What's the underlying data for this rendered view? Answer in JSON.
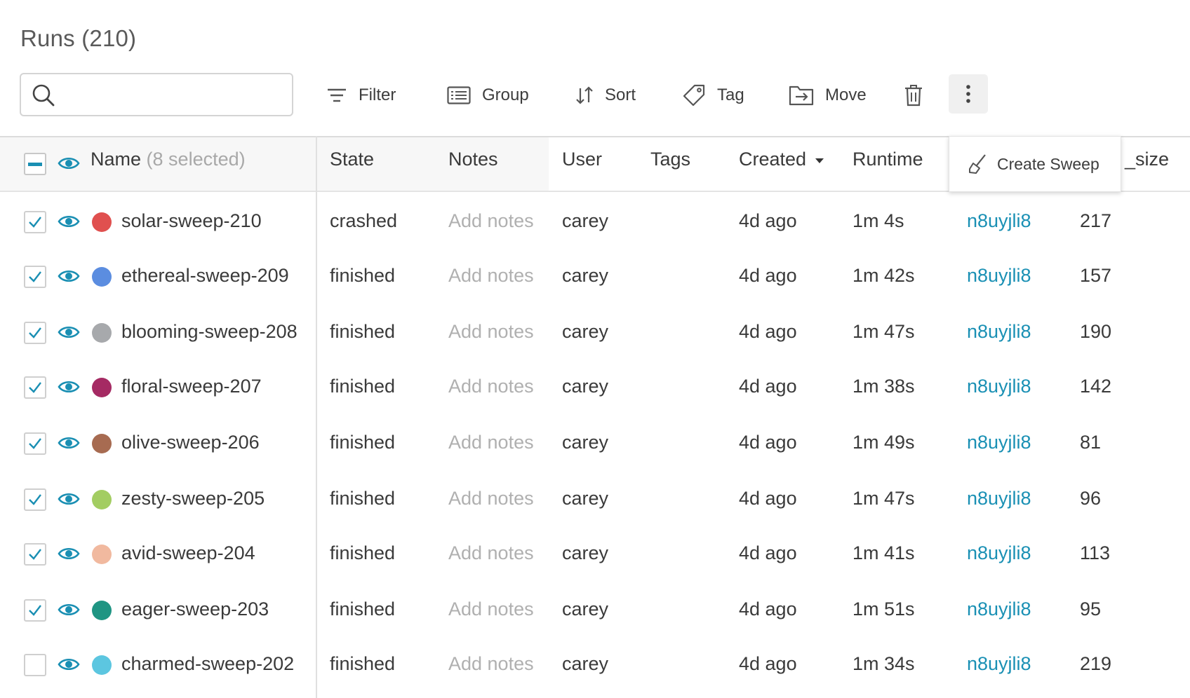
{
  "page": {
    "title": "Runs (210)"
  },
  "search": {
    "placeholder": "",
    "value": ""
  },
  "toolbar": {
    "filter": "Filter",
    "group": "Group",
    "sort": "Sort",
    "tag": "Tag",
    "move": "Move"
  },
  "popup": {
    "create_sweep": "Create Sweep"
  },
  "columns": {
    "name": "Name",
    "selected": "(8 selected)",
    "state": "State",
    "notes": "Notes",
    "user": "User",
    "tags": "Tags",
    "created": "Created",
    "runtime": "Runtime",
    "partial": "_size"
  },
  "colors": {
    "accent": "#1a90b4",
    "checkbox_blue": "#1a8fb3"
  },
  "rows": [
    {
      "checked": true,
      "color": "#e0504f",
      "name": "solar-sweep-210",
      "state": "crashed",
      "notes": "Add notes",
      "user": "carey",
      "created": "4d ago",
      "runtime": "1m 4s",
      "sweep": "n8uyjli8",
      "size": "217"
    },
    {
      "checked": true,
      "color": "#5b8de0",
      "name": "ethereal-sweep-209",
      "state": "finished",
      "notes": "Add notes",
      "user": "carey",
      "created": "4d ago",
      "runtime": "1m 42s",
      "sweep": "n8uyjli8",
      "size": "157"
    },
    {
      "checked": true,
      "color": "#a7a9ac",
      "name": "blooming-sweep-208",
      "state": "finished",
      "notes": "Add notes",
      "user": "carey",
      "created": "4d ago",
      "runtime": "1m 47s",
      "sweep": "n8uyjli8",
      "size": "190"
    },
    {
      "checked": true,
      "color": "#a52a63",
      "name": "floral-sweep-207",
      "state": "finished",
      "notes": "Add notes",
      "user": "carey",
      "created": "4d ago",
      "runtime": "1m 38s",
      "sweep": "n8uyjli8",
      "size": "142"
    },
    {
      "checked": true,
      "color": "#a76b51",
      "name": "olive-sweep-206",
      "state": "finished",
      "notes": "Add notes",
      "user": "carey",
      "created": "4d ago",
      "runtime": "1m 49s",
      "sweep": "n8uyjli8",
      "size": "81"
    },
    {
      "checked": true,
      "color": "#a3cd62",
      "name": "zesty-sweep-205",
      "state": "finished",
      "notes": "Add notes",
      "user": "carey",
      "created": "4d ago",
      "runtime": "1m 47s",
      "sweep": "n8uyjli8",
      "size": "96"
    },
    {
      "checked": true,
      "color": "#f1b99f",
      "name": "avid-sweep-204",
      "state": "finished",
      "notes": "Add notes",
      "user": "carey",
      "created": "4d ago",
      "runtime": "1m 41s",
      "sweep": "n8uyjli8",
      "size": "113"
    },
    {
      "checked": true,
      "color": "#1f9583",
      "name": "eager-sweep-203",
      "state": "finished",
      "notes": "Add notes",
      "user": "carey",
      "created": "4d ago",
      "runtime": "1m 51s",
      "sweep": "n8uyjli8",
      "size": "95"
    },
    {
      "checked": false,
      "color": "#5cc6e0",
      "name": "charmed-sweep-202",
      "state": "finished",
      "notes": "Add notes",
      "user": "carey",
      "created": "4d ago",
      "runtime": "1m 34s",
      "sweep": "n8uyjli8",
      "size": "219"
    }
  ]
}
